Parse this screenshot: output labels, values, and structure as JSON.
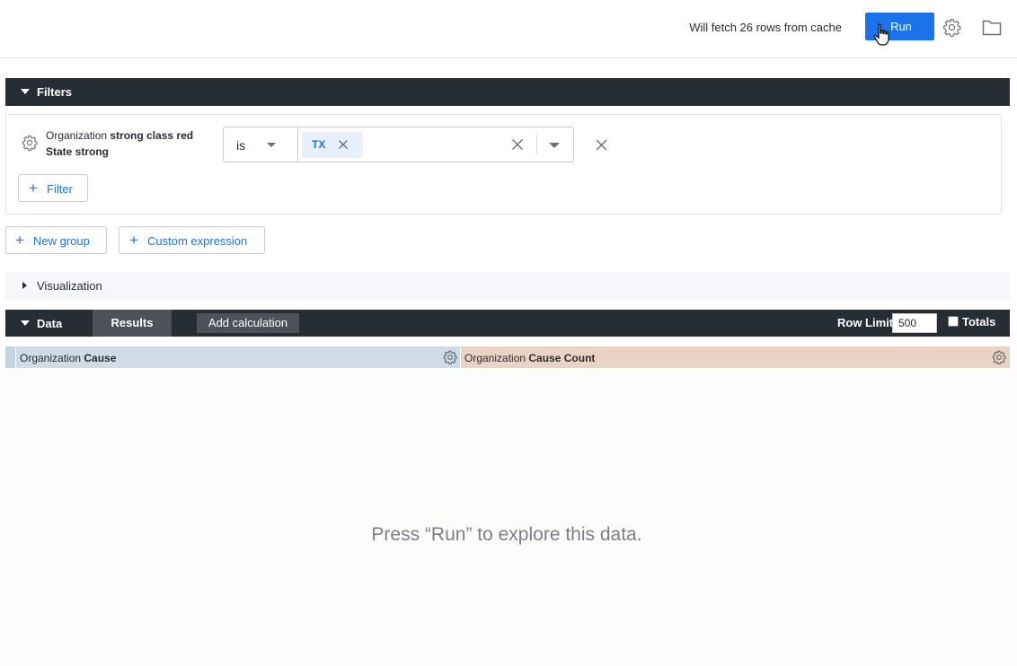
{
  "topbar": {
    "fetch_status": "Will fetch 26 rows from cache",
    "run_label": "Run",
    "icons": {
      "settings": "gear-icon",
      "folder": "folder-icon"
    }
  },
  "filters": {
    "title": "Filters",
    "rows": [
      {
        "field_prefix": "Organization",
        "field_strong": "strong class red",
        "field_line2": "State strong",
        "operator": "is",
        "values": [
          "TX"
        ]
      }
    ],
    "add_filter_label": "Filter"
  },
  "actions": {
    "new_group_label": "New group",
    "custom_expression_label": "Custom expression"
  },
  "visualization": {
    "title": "Visualization"
  },
  "data_bar": {
    "title": "Data",
    "results_tab": "Results",
    "add_calculation_label": "Add calculation",
    "row_limit_label": "Row Limit",
    "row_limit_value": "500",
    "totals_label": "Totals",
    "totals_checked": false
  },
  "columns": [
    {
      "prefix": "Organization",
      "name": "Cause",
      "kind": "dimension",
      "color": "#cfdbe6"
    },
    {
      "prefix": "Organization",
      "name": "Cause Count",
      "kind": "measure",
      "color": "#ebd3c4"
    }
  ],
  "empty_message": "Press “Run” to explore this data.",
  "colors": {
    "accent": "#1a73e8",
    "bar": "#262d33"
  }
}
